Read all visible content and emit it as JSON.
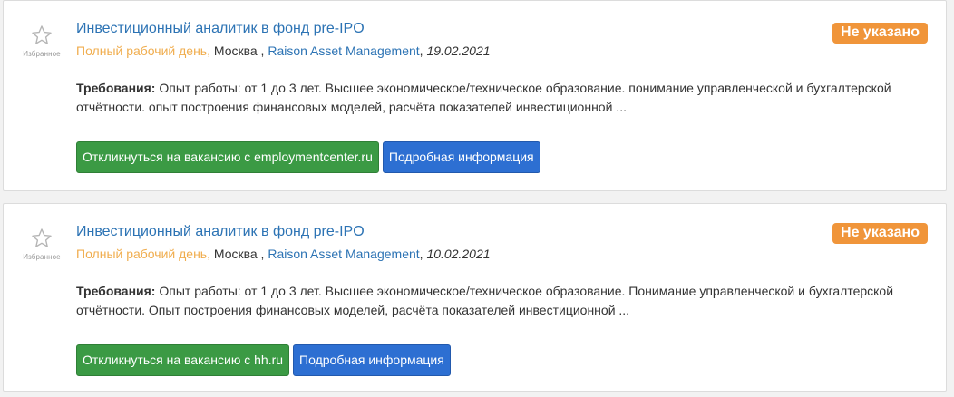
{
  "vacancies": [
    {
      "favorite_label": "Избранное",
      "title": "Инвестиционный аналитик в фонд pre-IPO",
      "schedule": "Полный рабочий день,",
      "city": "Москва",
      "city_sep": " ,",
      "company": "Raison Asset Management",
      "date_sep": ",",
      "date": "19.02.2021",
      "salary": "Не указано",
      "requirements_label": "Требования:",
      "requirements_text": "Опыт работы: от 1 до 3 лет. Высшее экономическое/техническое образование. понимание управленческой и бухгалтерской отчётности. опыт построения финансовых моделей, расчёта показателей инвестиционной ...",
      "apply_label": "Откликнуться на вакансию с employmentcenter.ru",
      "details_label": "Подробная информация"
    },
    {
      "favorite_label": "Избранное",
      "title": "Инвестиционный аналитик в фонд pre-IPO",
      "schedule": "Полный рабочий день,",
      "city": "Москва",
      "city_sep": " ,",
      "company": "Raison Asset Management",
      "date_sep": ",",
      "date": "10.02.2021",
      "salary": "Не указано",
      "requirements_label": "Требования:",
      "requirements_text": "Опыт работы: от 1 до 3 лет. Высшее экономическое/техническое образование. Понимание управленческой и бухгалтерской отчётности. Опыт построения финансовых моделей, расчёта показателей инвестиционной ...",
      "apply_label": "Откликнуться на вакансию с hh.ru",
      "details_label": "Подробная информация"
    }
  ],
  "icons": {
    "favorite": "star-outline-icon"
  },
  "colors": {
    "link": "#2c73b4",
    "schedule": "#f0ad4e",
    "salary_badge": "#f0953a",
    "apply_button": "#3b9a44",
    "details_button": "#2d6fd2"
  }
}
